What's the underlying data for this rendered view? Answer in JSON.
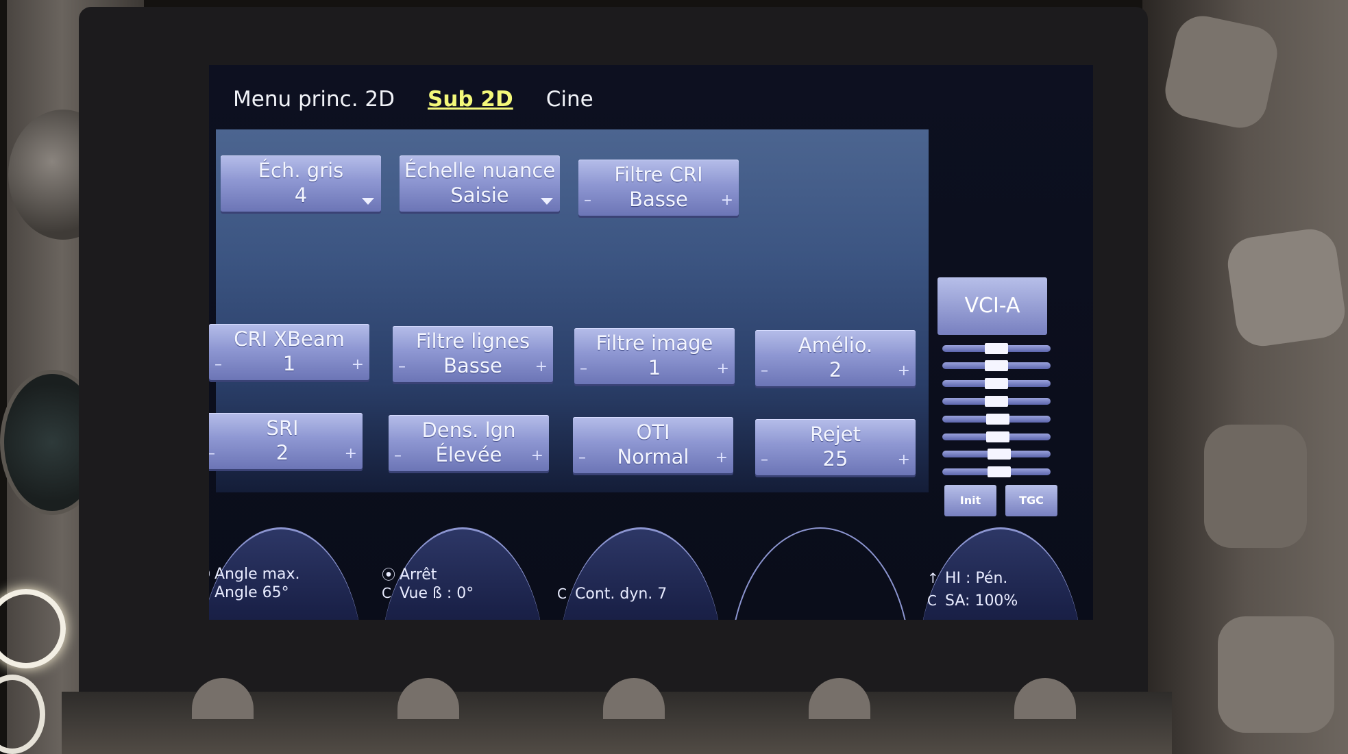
{
  "tabs": [
    {
      "label": "Menu princ. 2D",
      "active": false
    },
    {
      "label": "Sub 2D",
      "active": true
    },
    {
      "label": "Cine",
      "active": false
    }
  ],
  "row1": [
    {
      "label": "Éch. gris",
      "value": "4",
      "control": "dropdown"
    },
    {
      "label": "Échelle nuance",
      "value": "Saisie",
      "control": "dropdown"
    },
    {
      "label": "Filtre CRI",
      "value": "Basse",
      "control": "stepper"
    }
  ],
  "row2": [
    {
      "label": "CRI XBeam",
      "value": "1"
    },
    {
      "label": "Filtre lignes",
      "value": "Basse"
    },
    {
      "label": "Filtre image",
      "value": "1"
    },
    {
      "label": "Amélio.",
      "value": "2"
    }
  ],
  "row3": [
    {
      "label": "SRI",
      "value": "2"
    },
    {
      "label": "Dens. lgn",
      "value": "Élevée"
    },
    {
      "label": "OTI",
      "value": "Normal"
    },
    {
      "label": "Rejet",
      "value": "25"
    }
  ],
  "stepper": {
    "minus": "–",
    "plus": "+"
  },
  "tgc": {
    "preset": "VCI-A",
    "init_label": "Init",
    "tgc_label": "TGC",
    "slider_count": 8
  },
  "dials": [
    {
      "line1": "Angle max.",
      "line1_icon": "⦿",
      "line2": "Angle 65°",
      "line2_icon": "C"
    },
    {
      "line1": "Arrêt",
      "line1_icon": "⦿",
      "line2": "Vue ß :    0°",
      "line2_icon": "C"
    },
    {
      "line1": "",
      "line1_icon": "",
      "line2": "Cont. dyn. 7",
      "line2_icon": "C"
    },
    {
      "line1": "",
      "line1_icon": "",
      "line2": "",
      "line2_icon": ""
    },
    {
      "line1": "HI : Pén.",
      "line1_icon": "↑",
      "line2": "SA:  100%",
      "line2_icon": "C"
    }
  ],
  "colors": {
    "active_tab": "#f3f87a",
    "button": "#8e97d2",
    "panel": "#3c5582"
  }
}
